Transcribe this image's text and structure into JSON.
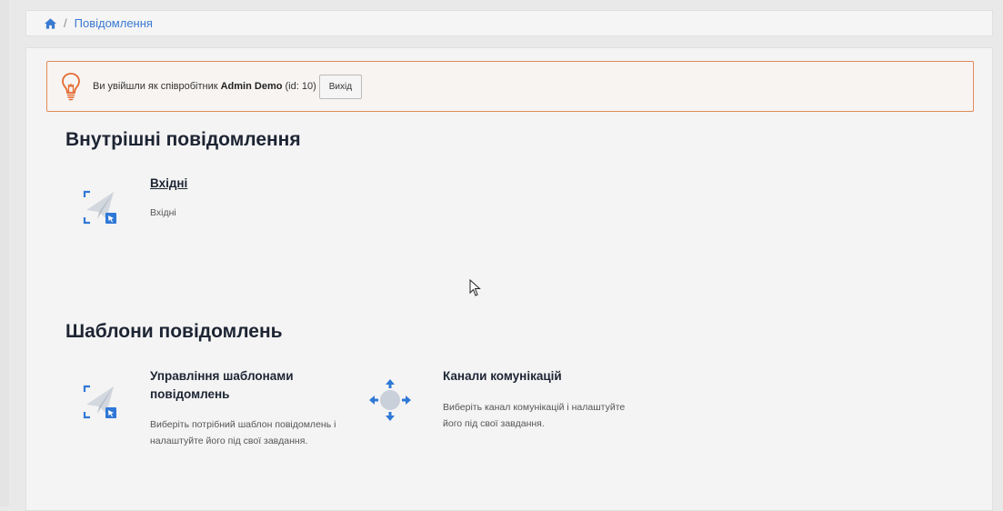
{
  "breadcrumb": {
    "home_icon": "home-icon",
    "separator": "/",
    "current": "Повідомлення"
  },
  "alert": {
    "icon": "lightbulb-icon",
    "prefix": "Ви увійшли як співробітник",
    "user_name": "Admin Demo",
    "user_id": "(id: 10)",
    "logout_label": "Вихід",
    "border_color": "#e38b5a"
  },
  "sections": [
    {
      "title": "Внутрішні повідомлення",
      "cards": [
        {
          "icon": "paper-plane-select-icon",
          "title": "Вхідні",
          "description": "Вхідні"
        }
      ]
    },
    {
      "title": "Шаблони повідомлень",
      "cards": [
        {
          "icon": "paper-plane-select-icon",
          "title": "Управління шаблонами повідомлень",
          "description": "Виберіть потрібний шаблон повідомлень і налаштуйте його під свої завдання."
        },
        {
          "icon": "move-arrows-icon",
          "title": "Канали комунікацій",
          "description": "Виберіть канал комунікацій і налаштуйте його під свої завдання."
        }
      ]
    }
  ],
  "colors": {
    "link": "#3a7ad1",
    "icon_blue": "#2f78d6",
    "heading": "#1d2433"
  }
}
